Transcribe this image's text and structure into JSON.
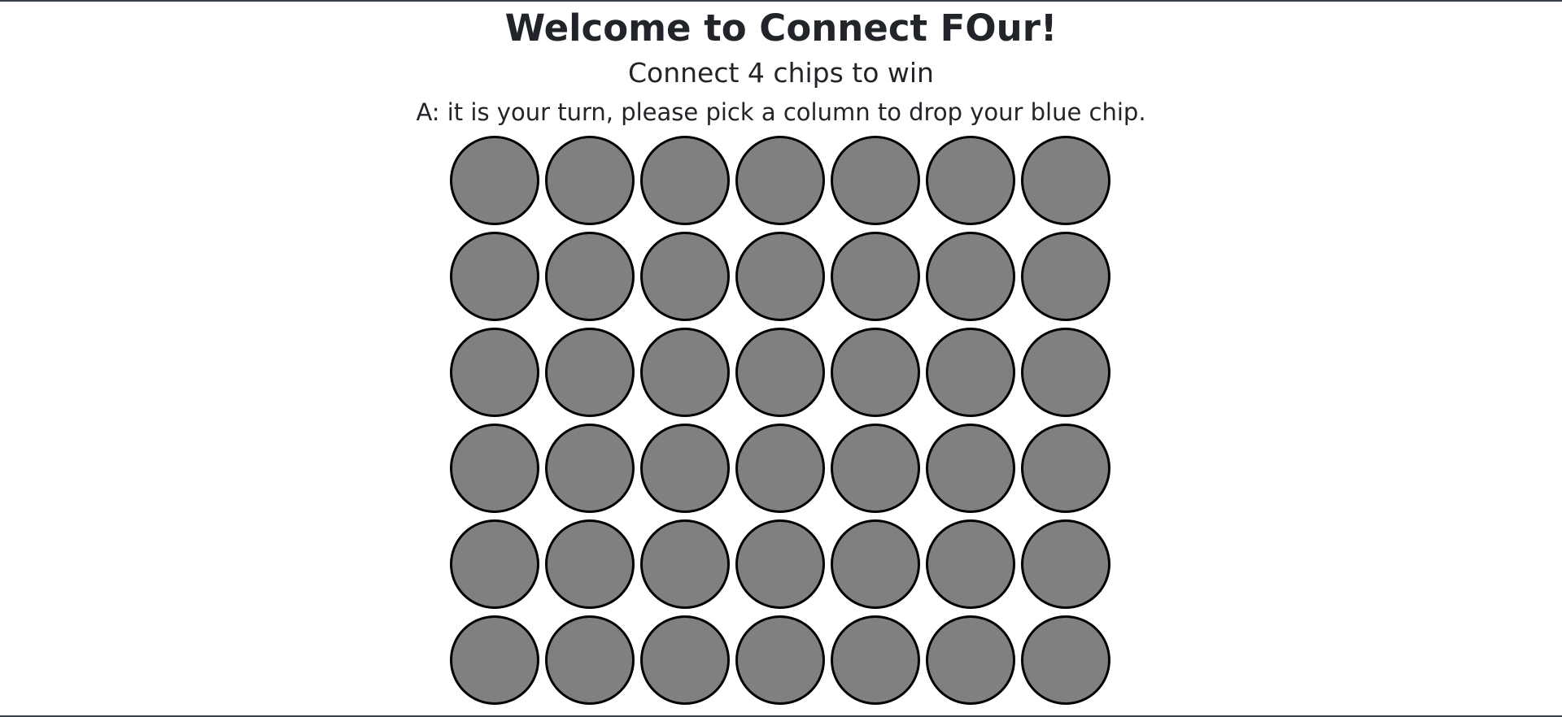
{
  "header": {
    "title": "Welcome to Connect FOur!",
    "subtitle": "Connect 4 chips to win",
    "status": "A: it is your turn, please pick a column to drop your blue chip."
  },
  "board": {
    "columns": 7,
    "rows": 6,
    "empty_color": "#808080",
    "cells": [
      [
        "empty",
        "empty",
        "empty",
        "empty",
        "empty",
        "empty",
        "empty"
      ],
      [
        "empty",
        "empty",
        "empty",
        "empty",
        "empty",
        "empty",
        "empty"
      ],
      [
        "empty",
        "empty",
        "empty",
        "empty",
        "empty",
        "empty",
        "empty"
      ],
      [
        "empty",
        "empty",
        "empty",
        "empty",
        "empty",
        "empty",
        "empty"
      ],
      [
        "empty",
        "empty",
        "empty",
        "empty",
        "empty",
        "empty",
        "empty"
      ],
      [
        "empty",
        "empty",
        "empty",
        "empty",
        "empty",
        "empty",
        "empty"
      ]
    ]
  },
  "colors": {
    "text": "#212529",
    "border": "#000000",
    "blue_chip": "#1e5bd8",
    "red_chip": "#d82a1e"
  }
}
